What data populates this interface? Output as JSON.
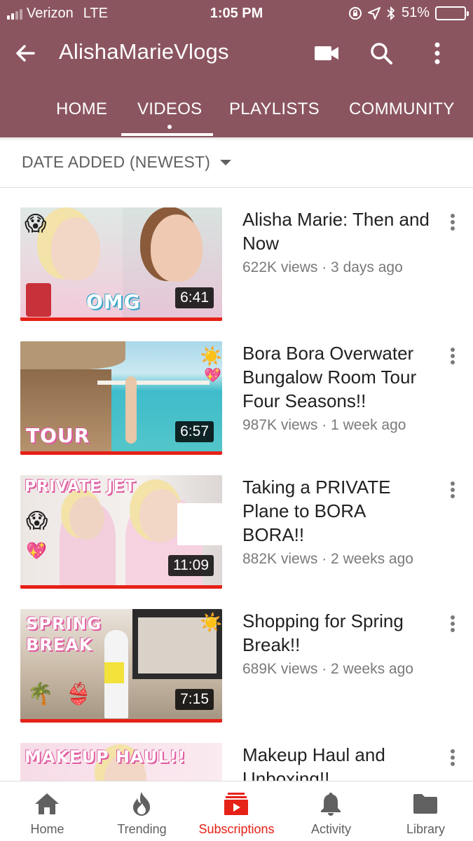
{
  "status_bar": {
    "carrier": "Verizon",
    "network": "LTE",
    "time": "1:05 PM",
    "battery": "51%",
    "battery_level": 0.51,
    "icons": [
      "rotation-lock-icon",
      "location-icon",
      "bluetooth-icon"
    ]
  },
  "app_bar": {
    "channel_name": "AlishaMarieVlogs",
    "color": "#8b5560",
    "icons": [
      "back-arrow-icon",
      "video-camera-icon",
      "search-icon",
      "more-vert-icon"
    ]
  },
  "tabs": [
    {
      "label": "HOME",
      "active": false
    },
    {
      "label": "VIDEOS",
      "active": true
    },
    {
      "label": "PLAYLISTS",
      "active": false
    },
    {
      "label": "COMMUNITY",
      "active": false
    }
  ],
  "sort": {
    "label": "DATE ADDED (NEWEST)"
  },
  "videos": [
    {
      "title": "Alisha Marie: Then and Now",
      "meta": "622K views · 3 days ago",
      "duration": "6:41",
      "overlay_text": "OMG",
      "thumb_bg": "#c9b8b0"
    },
    {
      "title": "Bora Bora Overwater Bungalow Room Tour Four Seasons!!",
      "meta": "987K views · 1 week ago",
      "duration": "6:57",
      "overlay_text": "TOUR",
      "thumb_bg": "#4fb9c7"
    },
    {
      "title": "Taking a PRIVATE Plane to BORA BORA!!",
      "meta": "882K views · 2 weeks ago",
      "duration": "11:09",
      "overlay_text": "PRIVATE JET",
      "thumb_bg": "#e4dcd8"
    },
    {
      "title": "Shopping for Spring Break!!",
      "meta": "689K views · 2 weeks ago",
      "duration": "7:15",
      "overlay_text": "SPRING BREAK",
      "thumb_bg": "#c7b9a8"
    },
    {
      "title": "Makeup Haul and Unboxing!!",
      "meta": "",
      "duration": "",
      "overlay_text": "MAKEUP HAUL!!",
      "thumb_bg": "#f3d9e4"
    }
  ],
  "bottom_nav": [
    {
      "label": "Home",
      "icon": "home-icon",
      "active": false
    },
    {
      "label": "Trending",
      "icon": "flame-icon",
      "active": false
    },
    {
      "label": "Subscriptions",
      "icon": "subscriptions-icon",
      "active": true
    },
    {
      "label": "Activity",
      "icon": "bell-icon",
      "active": false
    },
    {
      "label": "Library",
      "icon": "folder-icon",
      "active": false
    }
  ],
  "colors": {
    "accent": "#e62117",
    "header": "#8b5560",
    "meta_text": "#7a7a7a"
  }
}
